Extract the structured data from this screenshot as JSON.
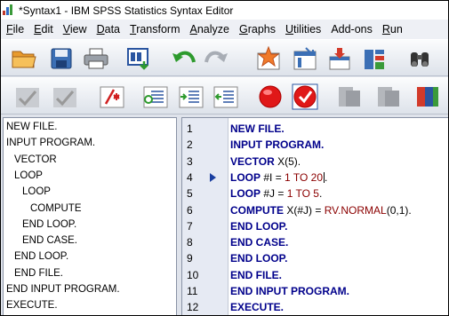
{
  "window": {
    "title": "*Syntax1 - IBM SPSS Statistics Syntax Editor"
  },
  "menubar": [
    {
      "label": "File",
      "ul": "F",
      "rest": "ile"
    },
    {
      "label": "Edit",
      "ul": "E",
      "rest": "dit"
    },
    {
      "label": "View",
      "ul": "V",
      "rest": "iew"
    },
    {
      "label": "Data",
      "ul": "D",
      "rest": "ata"
    },
    {
      "label": "Transform",
      "ul": "T",
      "rest": "ransform"
    },
    {
      "label": "Analyze",
      "ul": "A",
      "rest": "nalyze"
    },
    {
      "label": "Graphs",
      "ul": "G",
      "rest": "raphs"
    },
    {
      "label": "Utilities",
      "ul": "U",
      "rest": "tilities"
    },
    {
      "label": "Add-ons",
      "ul": "",
      "rest": "Add-ons"
    },
    {
      "label": "Run",
      "ul": "R",
      "rest": "un"
    }
  ],
  "toolbar1": [
    "open-folder-icon",
    "save-icon",
    "print-icon",
    "dialog-recall-icon",
    "undo-icon",
    "redo-icon",
    "goto-case-icon",
    "goto-variable-icon",
    "insert-variable-icon",
    "variables-icon",
    "find-icon"
  ],
  "toolbar2": [
    "run-selection-disabled-icon",
    "run-all-disabled-icon",
    "comment-toggle-icon",
    "indent-icon",
    "format-syntax-icon",
    "outdent-icon",
    "breakpoint-icon",
    "check-icon",
    "bookmark-disabled-icon",
    "bookmark-next-disabled-icon",
    "help-book-icon"
  ],
  "navigator": {
    "items": [
      {
        "text": "NEW FILE.",
        "indent": 0
      },
      {
        "text": "INPUT PROGRAM.",
        "indent": 0
      },
      {
        "text": "VECTOR",
        "indent": 1
      },
      {
        "text": "LOOP",
        "indent": 1
      },
      {
        "text": "LOOP",
        "indent": 2
      },
      {
        "text": "COMPUTE",
        "indent": 3
      },
      {
        "text": "END LOOP.",
        "indent": 2
      },
      {
        "text": "END CASE.",
        "indent": 2
      },
      {
        "text": "END LOOP.",
        "indent": 1
      },
      {
        "text": "END FILE.",
        "indent": 1
      },
      {
        "text": "END INPUT PROGRAM.",
        "indent": 0
      },
      {
        "text": "EXECUTE.",
        "indent": 0
      }
    ]
  },
  "editor": {
    "current_line": 4,
    "lines": [
      {
        "num": "1",
        "parts": [
          {
            "t": "NEW FILE.",
            "c": "kw"
          }
        ]
      },
      {
        "num": "2",
        "parts": [
          {
            "t": "INPUT PROGRAM.",
            "c": "kw"
          }
        ]
      },
      {
        "num": "3",
        "parts": [
          {
            "t": "VECTOR",
            "c": "kw"
          },
          {
            "t": " X(5).",
            "c": ""
          }
        ]
      },
      {
        "num": "4",
        "parts": [
          {
            "t": "LOOP",
            "c": "kw"
          },
          {
            "t": " #I = ",
            "c": ""
          },
          {
            "t": "1",
            "c": "num"
          },
          {
            "t": " TO ",
            "c": "num"
          },
          {
            "t": "20",
            "c": "num"
          },
          {
            "t": ".",
            "c": ""
          }
        ],
        "caret": true
      },
      {
        "num": "5",
        "parts": [
          {
            "t": "LOOP",
            "c": "kw"
          },
          {
            "t": " #J = ",
            "c": ""
          },
          {
            "t": "1",
            "c": "num"
          },
          {
            "t": " TO ",
            "c": "num"
          },
          {
            "t": "5",
            "c": "num"
          },
          {
            "t": ".",
            "c": ""
          }
        ]
      },
      {
        "num": "6",
        "parts": [
          {
            "t": "COMPUTE",
            "c": "kw"
          },
          {
            "t": " X(#J) = ",
            "c": ""
          },
          {
            "t": "RV.NORMAL",
            "c": "num"
          },
          {
            "t": "(0,1).",
            "c": ""
          }
        ]
      },
      {
        "num": "7",
        "parts": [
          {
            "t": "END LOOP.",
            "c": "kw"
          }
        ]
      },
      {
        "num": "8",
        "parts": [
          {
            "t": "END CASE.",
            "c": "kw"
          }
        ]
      },
      {
        "num": "9",
        "parts": [
          {
            "t": "END LOOP.",
            "c": "kw"
          }
        ]
      },
      {
        "num": "10",
        "parts": [
          {
            "t": "END FILE.",
            "c": "kw"
          }
        ]
      },
      {
        "num": "11",
        "parts": [
          {
            "t": "END INPUT PROGRAM.",
            "c": "kw"
          }
        ]
      },
      {
        "num": "12",
        "parts": [
          {
            "t": "EXECUTE.",
            "c": "kw"
          }
        ]
      }
    ]
  },
  "colors": {
    "keyword": "#00008b",
    "value": "#8b0000",
    "gutter": "#e6eaf3",
    "arrow": "#1a3fa0"
  }
}
